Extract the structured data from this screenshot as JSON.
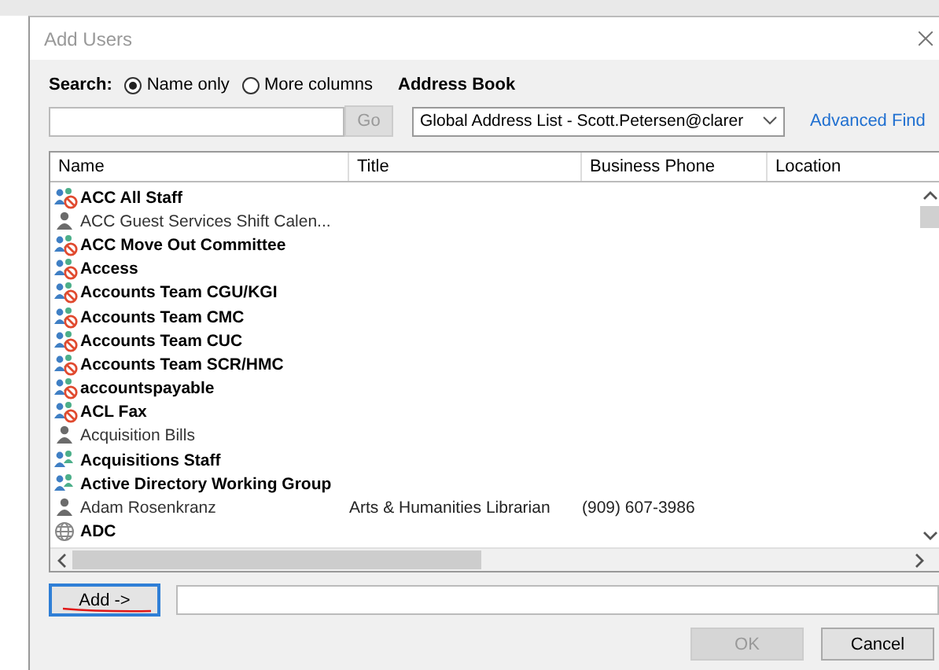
{
  "window": {
    "title": "Add Users"
  },
  "search": {
    "label": "Search:",
    "options": [
      {
        "label": "Name only",
        "selected": true
      },
      {
        "label": "More columns",
        "selected": false
      }
    ],
    "go_button": {
      "label": "Go",
      "disabled": true
    }
  },
  "address_book": {
    "label": "Address Book",
    "value": "Global Address List - Scott.Petersen@clarer",
    "advanced_find": "Advanced Find"
  },
  "table": {
    "columns": [
      "Name",
      "Title",
      "Business Phone",
      "Location"
    ],
    "rows": [
      {
        "kind": "blocked-group",
        "name": "ACC All Staff",
        "title": "",
        "phone": ""
      },
      {
        "kind": "user",
        "name": "ACC Guest Services Shift Calen...",
        "title": "",
        "phone": ""
      },
      {
        "kind": "blocked-group",
        "name": "ACC Move Out Committee",
        "title": "",
        "phone": ""
      },
      {
        "kind": "blocked-group",
        "name": "Access",
        "title": "",
        "phone": ""
      },
      {
        "kind": "blocked-group",
        "name": "Accounts Team CGU/KGI",
        "title": "",
        "phone": ""
      },
      {
        "kind": "blocked-group",
        "name": "Accounts Team CMC",
        "title": "",
        "phone": ""
      },
      {
        "kind": "blocked-group",
        "name": "Accounts Team CUC",
        "title": "",
        "phone": ""
      },
      {
        "kind": "blocked-group",
        "name": "Accounts Team SCR/HMC",
        "title": "",
        "phone": ""
      },
      {
        "kind": "blocked-group",
        "name": "accountspayable",
        "title": "",
        "phone": ""
      },
      {
        "kind": "blocked-group",
        "name": "ACL Fax",
        "title": "",
        "phone": ""
      },
      {
        "kind": "user",
        "name": "Acquisition Bills",
        "title": "",
        "phone": ""
      },
      {
        "kind": "group",
        "name": "Acquisitions Staff",
        "title": "",
        "phone": ""
      },
      {
        "kind": "group",
        "name": "Active Directory Working Group",
        "title": "",
        "phone": ""
      },
      {
        "kind": "user",
        "name": "Adam Rosenkranz",
        "title": "Arts & Humanities Librarian",
        "phone": "(909) 607-3986"
      },
      {
        "kind": "public-folder",
        "name": "ADC",
        "title": "",
        "phone": ""
      }
    ]
  },
  "add_button": {
    "label": "Add ->"
  },
  "buttons": [
    {
      "label": "OK",
      "disabled": true
    },
    {
      "label": "Cancel",
      "disabled": false
    }
  ]
}
